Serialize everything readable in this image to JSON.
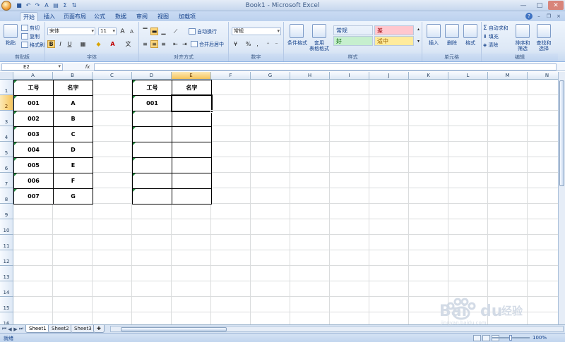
{
  "app": {
    "title": "Book1 - Microsoft Excel",
    "window_controls": [
      "—",
      "□",
      "✕"
    ]
  },
  "quick_access": [
    "save-icon",
    "undo-icon",
    "redo-icon",
    "font-color-icon",
    "print-icon",
    "sum-icon",
    "sort-icon"
  ],
  "tabs": [
    {
      "label": "开始",
      "active": true
    },
    {
      "label": "插入",
      "active": false
    },
    {
      "label": "页面布局",
      "active": false
    },
    {
      "label": "公式",
      "active": false
    },
    {
      "label": "数据",
      "active": false
    },
    {
      "label": "审阅",
      "active": false
    },
    {
      "label": "视图",
      "active": false
    },
    {
      "label": "加载项",
      "active": false
    }
  ],
  "ribbon": {
    "clipboard": {
      "label": "剪贴板",
      "paste": "粘贴",
      "cut": "剪切",
      "copy": "复制",
      "format_painter": "格式刷"
    },
    "font": {
      "label": "字体",
      "name": "宋体",
      "size": "11",
      "bold": "B",
      "italic": "I",
      "underline": "U",
      "grow": "A",
      "shrink": "A"
    },
    "alignment": {
      "label": "对齐方式",
      "wrap": "自动换行",
      "merge": "合并后居中"
    },
    "number": {
      "label": "数字",
      "format": "常规",
      "percent": "%",
      "comma": ","
    },
    "styles": {
      "label": "样式",
      "conditional": "条件格式",
      "table": "套用",
      "table2": "表格格式",
      "cells": [
        {
          "text": "常规",
          "bg": "#ffffff",
          "color": "#000000"
        },
        {
          "text": "差",
          "bg": "#ffc7ce",
          "color": "#9c0006"
        },
        {
          "text": "好",
          "bg": "#c6efce",
          "color": "#006100"
        },
        {
          "text": "适中",
          "bg": "#ffeb9c",
          "color": "#9c6500"
        }
      ]
    },
    "cells_group": {
      "label": "单元格",
      "insert": "插入",
      "delete": "删除",
      "format": "格式"
    },
    "editing": {
      "label": "编辑",
      "autosum": "自动求和",
      "fill": "填充",
      "clear": "清除",
      "sort": "排序和",
      "sort2": "筛选",
      "find": "查找和",
      "find2": "选择"
    }
  },
  "formula_bar": {
    "name_box": "E2",
    "fx": "fx",
    "content": ""
  },
  "columns": [
    "A",
    "B",
    "C",
    "D",
    "E",
    "F",
    "G",
    "H",
    "I",
    "J",
    "K",
    "L",
    "M",
    "N"
  ],
  "rows": [
    "1",
    "2",
    "3",
    "4",
    "5",
    "6",
    "7",
    "8",
    "9",
    "10",
    "11",
    "12",
    "13",
    "14",
    "15",
    "16"
  ],
  "selected_cell": "E2",
  "table1": {
    "headers": [
      "工号",
      "名字"
    ],
    "rows": [
      [
        "001",
        "A"
      ],
      [
        "002",
        "B"
      ],
      [
        "003",
        "C"
      ],
      [
        "004",
        "D"
      ],
      [
        "005",
        "E"
      ],
      [
        "006",
        "F"
      ],
      [
        "007",
        "G"
      ]
    ]
  },
  "table2": {
    "headers": [
      "工号",
      "名字"
    ],
    "rows": [
      [
        "001",
        ""
      ],
      [
        "",
        ""
      ],
      [
        "",
        ""
      ],
      [
        "",
        ""
      ],
      [
        "",
        ""
      ],
      [
        "",
        ""
      ],
      [
        "",
        ""
      ]
    ]
  },
  "sheets": [
    {
      "label": "Sheet1",
      "active": true
    },
    {
      "label": "Sheet2",
      "active": false
    },
    {
      "label": "Sheet3",
      "active": false
    }
  ],
  "status": {
    "text": "就绪",
    "zoom": "100%"
  },
  "colors": {
    "accent": "#15428b",
    "selection": "#f5c45c",
    "grid": "#dadcdd"
  }
}
